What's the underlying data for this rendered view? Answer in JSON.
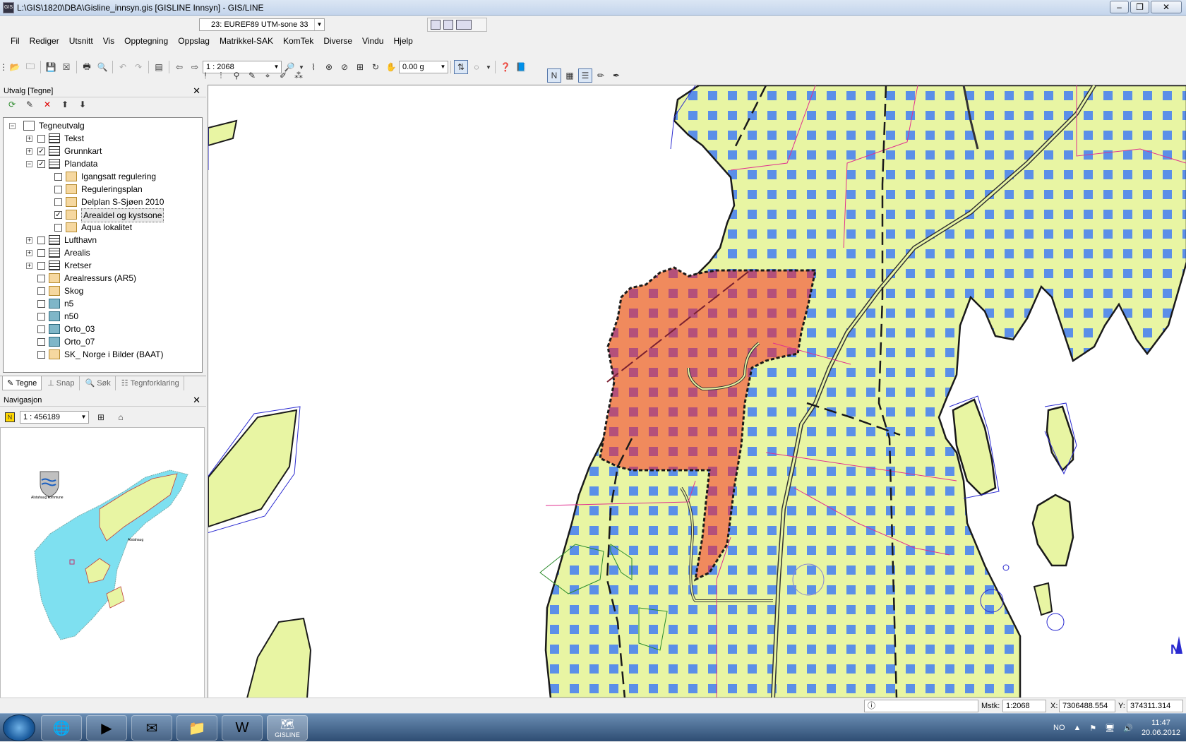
{
  "window": {
    "title": "L:\\GIS\\1820\\DBA\\Gisline_innsyn.gis [GISLINE Innsyn] - GIS/LINE"
  },
  "projection": {
    "value": "23: EUREF89 UTM-sone 33"
  },
  "menu": {
    "items": [
      "Fil",
      "Rediger",
      "Utsnitt",
      "Vis",
      "Opptegning",
      "Oppslag",
      "Matrikkel-SAK",
      "KomTek",
      "Diverse",
      "Vindu",
      "Hjelp"
    ]
  },
  "toolbar": {
    "scale": "1 : 2068",
    "angle": "0.00 g"
  },
  "panel": {
    "title": "Utvalg [Tegne]"
  },
  "tree": {
    "root": "Tegneutvalg",
    "items": [
      {
        "label": "Tekst",
        "checked": false
      },
      {
        "label": "Grunnkart",
        "checked": true
      },
      {
        "label": "Plandata",
        "checked": true
      },
      {
        "label": "Igangsatt regulering",
        "checked": false
      },
      {
        "label": "Reguleringsplan",
        "checked": false
      },
      {
        "label": "Delplan S-Sjøen 2010",
        "checked": false
      },
      {
        "label": "Arealdel og kystsone",
        "checked": true
      },
      {
        "label": "Aqua lokalitet",
        "checked": false
      },
      {
        "label": "Lufthavn",
        "checked": false
      },
      {
        "label": "Arealis",
        "checked": false
      },
      {
        "label": "Kretser",
        "checked": false
      },
      {
        "label": "Arealressurs (AR5)",
        "checked": false
      },
      {
        "label": "Skog",
        "checked": false
      },
      {
        "label": "n5",
        "checked": false
      },
      {
        "label": "n50",
        "checked": false
      },
      {
        "label": "Orto_03",
        "checked": false
      },
      {
        "label": "Orto_07",
        "checked": false
      },
      {
        "label": "SK_ Norge i Bilder (BAAT)",
        "checked": false
      }
    ]
  },
  "tabs": [
    "Tegne",
    "Snap",
    "Søk",
    "Tegnforklaring"
  ],
  "navigation": {
    "title": "Navigasjon",
    "scale": "1 : 456189",
    "label_kommune": "Alstahaug kommune",
    "label_place": "Alstahaug"
  },
  "status": {
    "mstk_label": "Mstk:",
    "mstk": "1:2068",
    "x_label": "X:",
    "x": "7306488.554",
    "y_label": "Y:",
    "y": "374311.314"
  },
  "taskbar": {
    "lang": "NO",
    "time": "11:47",
    "date": "20.06.2012",
    "app_label": "GISLINE"
  },
  "colors": {
    "land": "#e8f5a3",
    "square": "#5b8fe8",
    "highlight": "#f08a5d",
    "highlight_square": "#b4507a",
    "coast": "#1a1a1a",
    "water_outline": "#2a2ad0",
    "boundary": "#e0308f"
  }
}
